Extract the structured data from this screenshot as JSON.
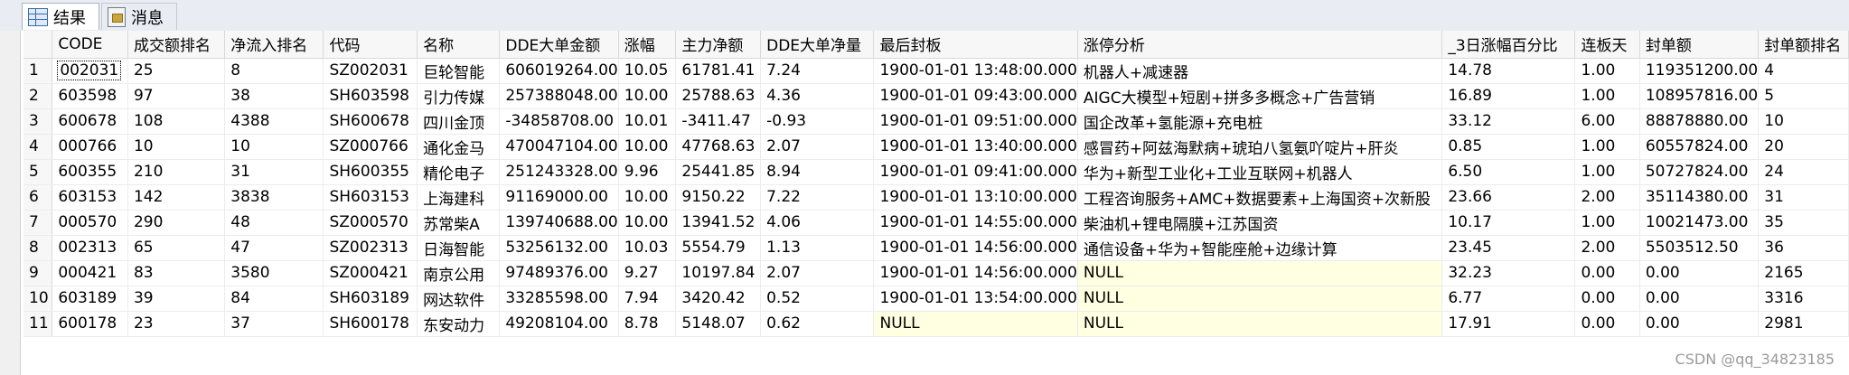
{
  "tabs": [
    {
      "label": "结果",
      "icon": "grid-icon",
      "active": true
    },
    {
      "label": "消息",
      "icon": "message-icon",
      "active": false
    }
  ],
  "columns": [
    "",
    "CODE",
    "成交额排名",
    "净流入排名",
    "代码",
    "名称",
    "DDE大单金额",
    "涨幅",
    "主力净额",
    "DDE大单净量",
    "最后封板",
    "涨停分析",
    "_3日涨幅百分比",
    "连板天",
    "封单额",
    "封单额排名"
  ],
  "rows": [
    [
      "1",
      "002031",
      "25",
      "8",
      "SZ002031",
      "巨轮智能",
      "606019264.00",
      "10.05",
      "61781.41",
      "7.24",
      "1900-01-01 13:48:00.000",
      "机器人+减速器",
      "14.78",
      "1.00",
      "119351200.00",
      "4"
    ],
    [
      "2",
      "603598",
      "97",
      "38",
      "SH603598",
      "引力传媒",
      "257388048.00",
      "10.00",
      "25788.63",
      "4.36",
      "1900-01-01 09:43:00.000",
      "AIGC大模型+短剧+拼多多概念+广告营销",
      "16.89",
      "1.00",
      "108957816.00",
      "5"
    ],
    [
      "3",
      "600678",
      "108",
      "4388",
      "SH600678",
      "四川金顶",
      "-34858708.00",
      "10.01",
      "-3411.47",
      "-0.93",
      "1900-01-01 09:51:00.000",
      "国企改革+氢能源+充电桩",
      "33.12",
      "6.00",
      "88878880.00",
      "10"
    ],
    [
      "4",
      "000766",
      "10",
      "10",
      "SZ000766",
      "通化金马",
      "470047104.00",
      "10.00",
      "47768.63",
      "2.07",
      "1900-01-01 13:40:00.000",
      "感冒药+阿兹海默病+琥珀八氢氨吖啶片+肝炎",
      "0.85",
      "1.00",
      "60557824.00",
      "20"
    ],
    [
      "5",
      "600355",
      "210",
      "31",
      "SH600355",
      "精伦电子",
      "251243328.00",
      "9.96",
      "25441.85",
      "8.94",
      "1900-01-01 09:41:00.000",
      "华为+新型工业化+工业互联网+机器人",
      "6.50",
      "1.00",
      "50727824.00",
      "24"
    ],
    [
      "6",
      "603153",
      "142",
      "3838",
      "SH603153",
      "上海建科",
      "91169000.00",
      "10.00",
      "9150.22",
      "7.22",
      "1900-01-01 13:10:00.000",
      "工程咨询服务+AMC+数据要素+上海国资+次新股",
      "23.66",
      "2.00",
      "35114380.00",
      "31"
    ],
    [
      "7",
      "000570",
      "290",
      "48",
      "SZ000570",
      "苏常柴A",
      "139740688.00",
      "10.00",
      "13941.52",
      "4.06",
      "1900-01-01 14:55:00.000",
      "柴油机+锂电隔膜+江苏国资",
      "10.17",
      "1.00",
      "10021473.00",
      "35"
    ],
    [
      "8",
      "002313",
      "65",
      "47",
      "SZ002313",
      "日海智能",
      "53256132.00",
      "10.03",
      "5554.79",
      "1.13",
      "1900-01-01 14:56:00.000",
      "通信设备+华为+智能座舱+边缘计算",
      "23.45",
      "2.00",
      "5503512.50",
      "36"
    ],
    [
      "9",
      "000421",
      "83",
      "3580",
      "SZ000421",
      "南京公用",
      "97489376.00",
      "9.27",
      "10197.84",
      "2.07",
      "1900-01-01 14:56:00.000",
      "NULL",
      "32.23",
      "0.00",
      "0.00",
      "2165"
    ],
    [
      "10",
      "603189",
      "39",
      "84",
      "SH603189",
      "网达软件",
      "33285598.00",
      "7.94",
      "3420.42",
      "0.52",
      "1900-01-01 13:54:00.000",
      "NULL",
      "6.77",
      "0.00",
      "0.00",
      "3316"
    ],
    [
      "11",
      "600178",
      "23",
      "37",
      "SH600178",
      "东安动力",
      "49208104.00",
      "8.78",
      "5148.07",
      "0.62",
      "NULL",
      "NULL",
      "17.91",
      "0.00",
      "0.00",
      "2981"
    ]
  ],
  "selected_cell": {
    "row": 0,
    "col": 1
  },
  "null_color": "#ffffe1",
  "watermark": "CSDN @qq_34823185"
}
